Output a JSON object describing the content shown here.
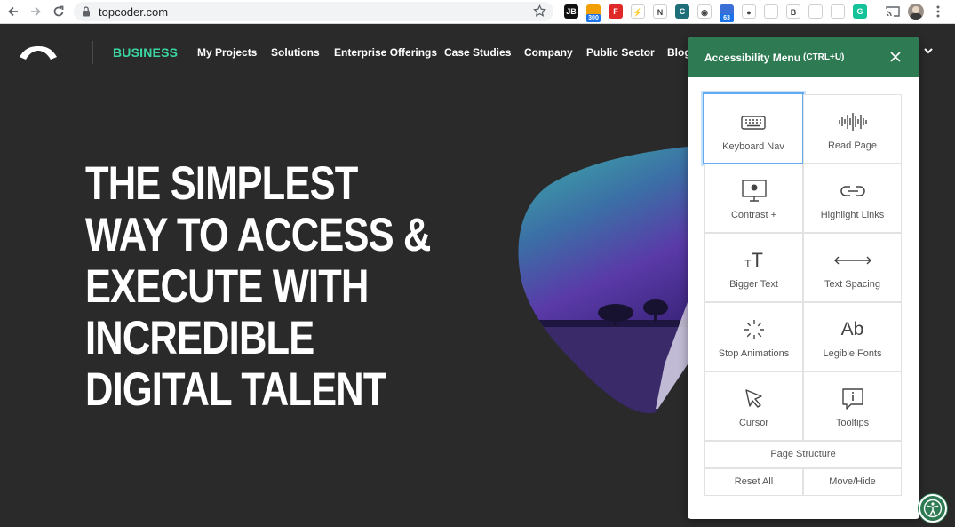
{
  "browser": {
    "url": "topcoder.com",
    "extensions": [
      {
        "name": "jb-ext",
        "text": "JB",
        "color": "#111111"
      },
      {
        "name": "feed-ext",
        "text": "",
        "color": "#f29f05",
        "badge": "300"
      },
      {
        "name": "flipboard-ext",
        "text": "F",
        "color": "#e12828"
      },
      {
        "name": "lightning-ext",
        "text": "⚡",
        "color": "#ffffff"
      },
      {
        "name": "n-ext",
        "text": "N",
        "color": "#ffffff"
      },
      {
        "name": "c-ext",
        "text": "C",
        "color": "#1f6f7a"
      },
      {
        "name": "sound-ext",
        "text": "◉",
        "color": "#ffffff"
      },
      {
        "name": "earth-ext",
        "text": "",
        "color": "#3a6fd8",
        "badge": "63"
      },
      {
        "name": "circle-ext",
        "text": "●",
        "color": "#ffffff"
      },
      {
        "name": "dropbox-ext",
        "text": "",
        "color": "#ffffff"
      },
      {
        "name": "b-ext",
        "text": "B",
        "color": "#c8c8c8"
      },
      {
        "name": "box-ext",
        "text": "",
        "color": "#ffffff"
      },
      {
        "name": "shield-ext",
        "text": "",
        "color": "#ffffff"
      },
      {
        "name": "grammarly-ext",
        "text": "G",
        "color": "#15c39a"
      }
    ]
  },
  "header": {
    "brand": "BUSINESS",
    "nav": [
      "My Projects",
      "Solutions",
      "Enterprise Offerings",
      "Case Studies",
      "Company",
      "Public Sector",
      "Blog"
    ]
  },
  "hero": {
    "lines": [
      "THE SIMPLEST",
      "WAY TO ACCESS &",
      "EXECUTE WITH",
      "INCREDIBLE",
      "DIGITAL TALENT"
    ]
  },
  "a11y": {
    "title": "Accessibility Menu",
    "shortcut": "(CTRL+U)",
    "tools": [
      {
        "label": "Keyboard Nav",
        "icon": "keyboard-icon"
      },
      {
        "label": "Read Page",
        "icon": "soundwave-icon"
      },
      {
        "label": "Contrast +",
        "icon": "monitor-icon"
      },
      {
        "label": "Highlight Links",
        "icon": "link-icon"
      },
      {
        "label": "Bigger Text",
        "icon": "text-size-icon"
      },
      {
        "label": "Text Spacing",
        "icon": "horizontal-arrows-icon"
      },
      {
        "label": "Stop Animations",
        "icon": "spinner-icon"
      },
      {
        "label": "Legible Fonts",
        "icon": "ab-font-icon"
      },
      {
        "label": "Cursor",
        "icon": "cursor-icon"
      },
      {
        "label": "Tooltips",
        "icon": "tooltip-icon"
      }
    ],
    "page_structure": "Page Structure",
    "reset_all": "Reset All",
    "move_hide": "Move/Hide",
    "ab_glyph": "Ab",
    "tt_small": "T",
    "tt_big": "T"
  },
  "colors": {
    "accent": "#2d7a53",
    "brand_green": "#3bd6a0",
    "background": "#2a2a2a"
  }
}
